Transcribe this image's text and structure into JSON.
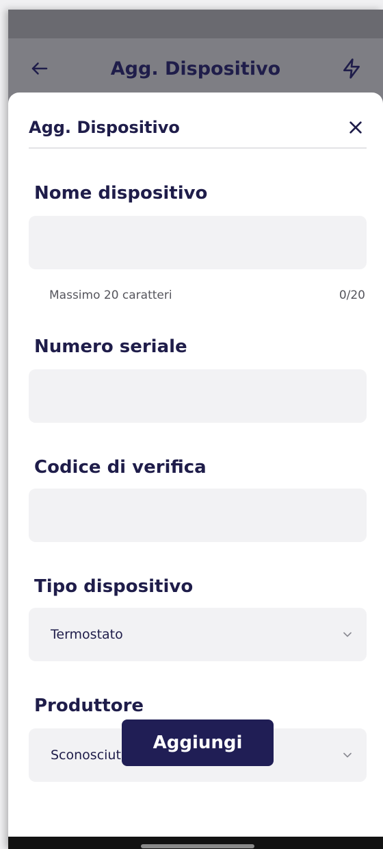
{
  "header": {
    "title": "Agg. Dispositivo",
    "back_icon": "arrow-left-icon",
    "action_icon": "lightning-icon"
  },
  "sheet": {
    "title": "Agg. Dispositivo",
    "close_icon": "close-icon"
  },
  "form": {
    "device_name": {
      "label": "Nome dispositivo",
      "value": "",
      "helper": "Massimo 20 caratteri",
      "counter": "0/20"
    },
    "serial_number": {
      "label": "Numero seriale",
      "value": ""
    },
    "verification_code": {
      "label": "Codice di verifica",
      "value": ""
    },
    "device_type": {
      "label": "Tipo dispositivo",
      "selected": "Termostato"
    },
    "manufacturer": {
      "label": "Produttore",
      "selected": "Sconosciuto"
    }
  },
  "submit_label": "Aggiungi",
  "colors": {
    "primary": "#201e55",
    "text": "#1f1d4a",
    "field_bg": "#f2f2f4",
    "overlay": "#7e7e84"
  }
}
